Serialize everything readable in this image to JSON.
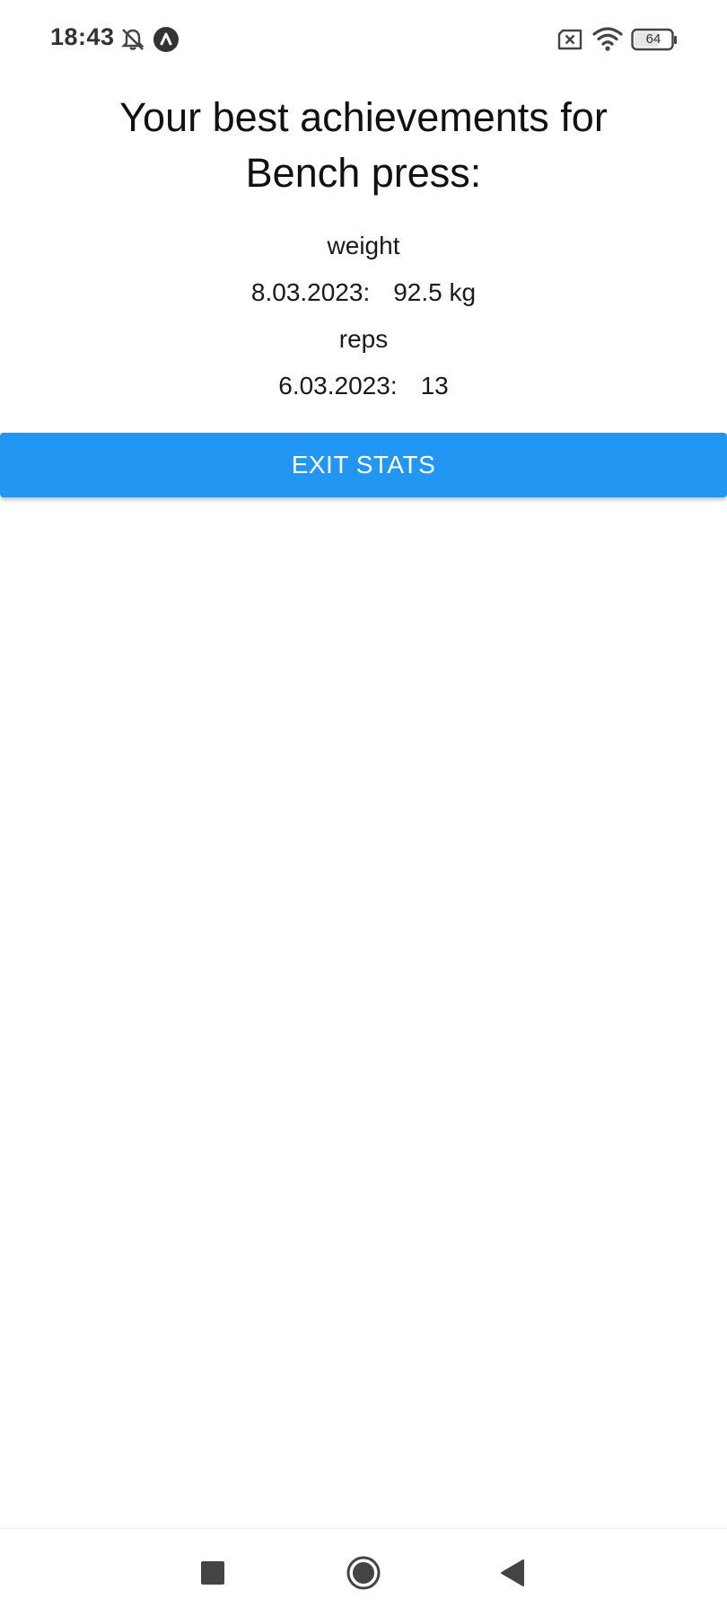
{
  "status_bar": {
    "time": "18:43",
    "battery_level": "64",
    "icons": [
      "bell-muted-icon",
      "app-notification-icon",
      "sim-error-icon",
      "wifi-icon",
      "battery-icon"
    ]
  },
  "page": {
    "title_line1": "Your best achievements for",
    "title_line2": "Bench press:"
  },
  "stats": {
    "weight": {
      "label": "weight",
      "date": "8.03.2023:",
      "value": "92.5 kg"
    },
    "reps": {
      "label": "reps",
      "date": "6.03.2023:",
      "value": "13"
    }
  },
  "actions": {
    "exit_label": "EXIT STATS"
  },
  "colors": {
    "accent": "#2196f3",
    "background": "#ffffff"
  },
  "nav_bar": {
    "buttons": [
      "recents-square-icon",
      "home-circle-icon",
      "back-triangle-icon"
    ]
  }
}
